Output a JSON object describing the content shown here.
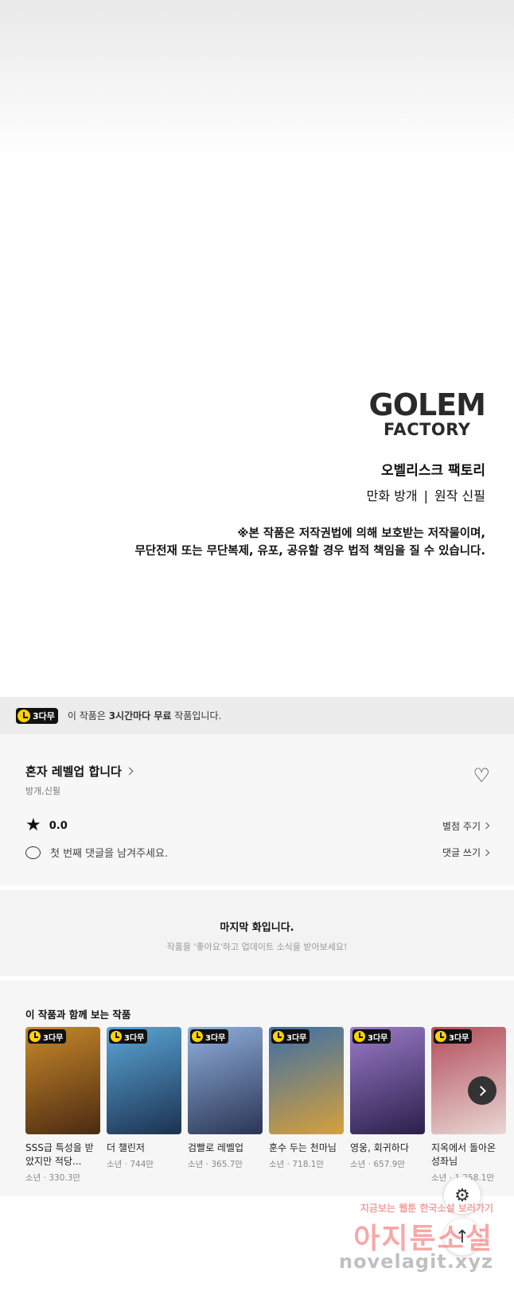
{
  "credits": {
    "logo_line1": "GOLEM",
    "logo_line2": "FACTORY",
    "studio": "오벨리스크 팩토리",
    "art": "만화 방개",
    "separator": "|",
    "story": "원작 신필",
    "copyright_line1": "※본 작품은 저작권법에 의해 보호받는 저작물이며,",
    "copyright_line2": "무단전재 또는 무단복제, 유포, 공유할 경우 법적 책임을 질 수 있습니다."
  },
  "free_banner": {
    "badge": "3다무",
    "text_before": "이 작품은 ",
    "text_bold": "3시간마다 무료",
    "text_after": " 작품입니다."
  },
  "series": {
    "title": "혼자 레벨업 합니다",
    "authors": "방개,신필",
    "rating": "0.0",
    "rate_link": "별점 주기",
    "comment_placeholder": "첫 번째 댓글을 남겨주세요.",
    "comment_link": "댓글 쓰기"
  },
  "last_episode": {
    "title": "마지막 화입니다.",
    "subtitle": "작품을 '좋아요'하고 업데이트 소식을 받아보세요!"
  },
  "recommendations": {
    "title": "이 작품과 함께 보는 작품",
    "badge": "3다무",
    "items": [
      {
        "title": "SSS급 특성을 받았지만 적당...",
        "meta": "소년 · 330.3만",
        "color1": "#c9892a",
        "color2": "#4a2a12"
      },
      {
        "title": "더 챌린저",
        "meta": "소년 · 744만",
        "color1": "#5aa7d8",
        "color2": "#1c3150"
      },
      {
        "title": "검빨로 레벨업",
        "meta": "소년 · 365.7만",
        "color1": "#8fb0dd",
        "color2": "#2b3554"
      },
      {
        "title": "훈수 두는 천마님",
        "meta": "소년 · 718.1만",
        "color1": "#3a6fa8",
        "color2": "#d7a03a"
      },
      {
        "title": "영웅, 회귀하다",
        "meta": "소년 · 657.9만",
        "color1": "#9a7bc9",
        "color2": "#2b1f4a"
      },
      {
        "title": "지옥에서 돌아온 성좌님",
        "meta": "소년 · 1,258.1만",
        "color1": "#b34c5a",
        "color2": "#e8d8d4"
      }
    ]
  },
  "watermark": {
    "line1": "지금보는 웹툰 한국소설 보러가기",
    "line2": "아지툰소설",
    "line3": "novelagit.xyz"
  },
  "icons": {
    "heart": "heart-icon",
    "star": "star-icon",
    "comment": "comment-icon",
    "settings": "gear-icon",
    "to_top": "arrow-up-icon",
    "next": "chevron-right-icon"
  }
}
